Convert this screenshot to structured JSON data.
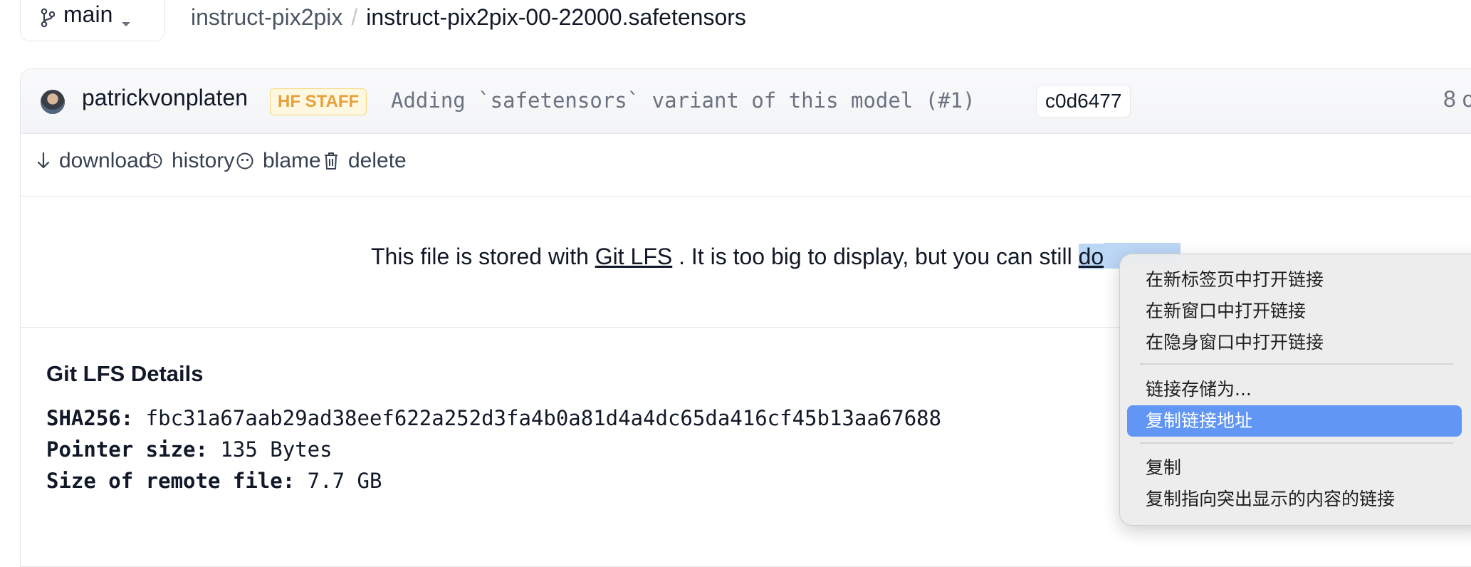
{
  "branch": {
    "name": "main"
  },
  "breadcrumb": {
    "repo": "instruct-pix2pix",
    "separator": "/",
    "file": "instruct-pix2pix-00-22000.safetensors"
  },
  "commit": {
    "author": "patrickvonplaten",
    "badge": "HF STAFF",
    "message": "Adding `safetensors` variant of this model (#1)",
    "sha": "c0d6477",
    "time_partial": "8 c"
  },
  "actions": [
    {
      "label": "download",
      "icon": "arrow-down-icon"
    },
    {
      "label": "history",
      "icon": "clock-icon"
    },
    {
      "label": "blame",
      "icon": "face-icon"
    },
    {
      "label": "delete",
      "icon": "trash-icon"
    }
  ],
  "notice": {
    "prefix": "This file is stored with ",
    "link": "Git LFS",
    "middle": " . It is too big to display, but you can still ",
    "download_partial": "do"
  },
  "lfs_details": {
    "title": "Git LFS Details",
    "sha_label": "SHA256:",
    "sha_value": " fbc31a67aab29ad38eef622a252d3fa4b0a81d4a4dc65da416cf45b13aa67688",
    "pointer_label": "Pointer size:",
    "pointer_value": " 135 Bytes",
    "remote_label": "Size of remote file:",
    "remote_value": " 7.7 GB"
  },
  "context_menu": {
    "items": [
      "在新标签页中打开链接",
      "在新窗口中打开链接",
      "在隐身窗口中打开链接",
      "链接存储为...",
      "复制链接地址",
      "复制",
      "复制指向突出显示的内容的链接"
    ],
    "highlighted": "复制链接地址"
  },
  "colors": {
    "badge": "#e7a13b",
    "menu_highlight": "#6296f5",
    "selection": "#bcd6f5"
  }
}
